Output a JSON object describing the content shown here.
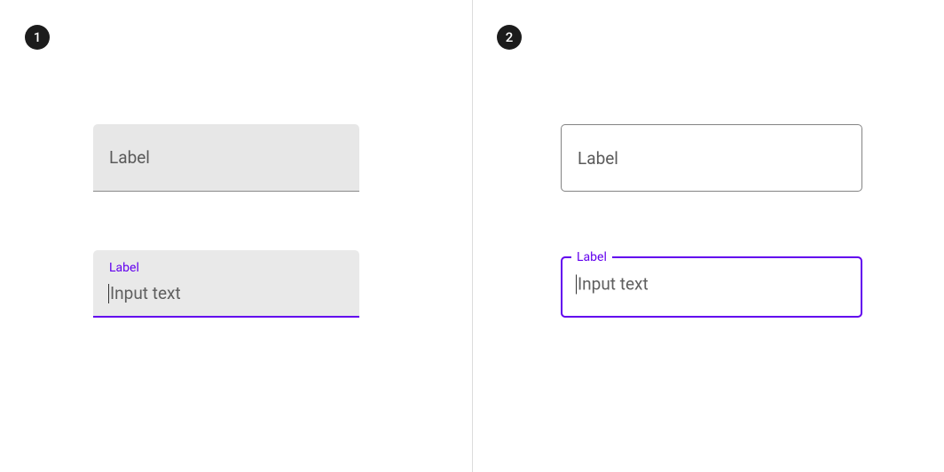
{
  "panels": {
    "left": {
      "badge": "1",
      "filled_unfocused": {
        "label": "Label"
      },
      "filled_focused": {
        "label": "Label",
        "input_text": "Input text"
      }
    },
    "right": {
      "badge": "2",
      "outlined_unfocused": {
        "label": "Label"
      },
      "outlined_focused": {
        "label": "Label",
        "input_text": "Input text"
      }
    }
  },
  "colors": {
    "accent": "#6200ee",
    "filled_bg": "#e7e7e7",
    "text_muted": "#5a5a5a"
  }
}
